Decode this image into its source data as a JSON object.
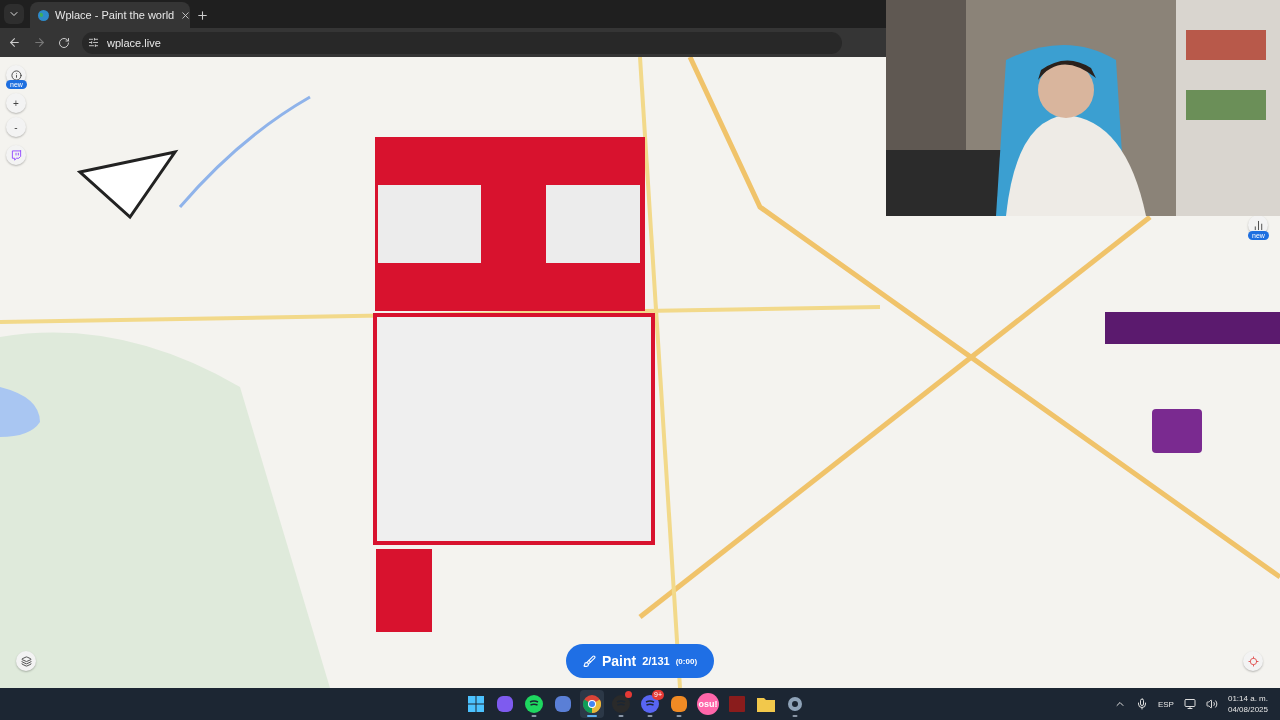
{
  "browser": {
    "tab": {
      "title": "Wplace - Paint the world",
      "selected": true
    },
    "url": "wplace.live"
  },
  "map_controls": {
    "info_badge": "new",
    "zoom_in": "+",
    "zoom_out": "-",
    "leaderboard_badge": "new"
  },
  "paint_button": {
    "label": "Paint",
    "count": "2/131",
    "timer": "(0:00)"
  },
  "taskbar": {
    "apps": [
      {
        "kind": "start",
        "running": false,
        "selected": false
      },
      {
        "kind": "copilot",
        "running": false,
        "selected": false
      },
      {
        "kind": "spotify",
        "running": true,
        "selected": false
      },
      {
        "kind": "vpn",
        "running": false,
        "selected": false
      },
      {
        "kind": "chrome",
        "running": true,
        "selected": true
      },
      {
        "kind": "obs",
        "running": true,
        "selected": false,
        "dot": true
      },
      {
        "kind": "discord",
        "running": true,
        "selected": false,
        "badge": "9+"
      },
      {
        "kind": "fl",
        "running": true,
        "selected": false
      },
      {
        "kind": "osu",
        "running": false,
        "selected": false,
        "label": "osu!"
      },
      {
        "kind": "game",
        "running": false,
        "selected": false
      },
      {
        "kind": "folder",
        "running": false,
        "selected": false
      },
      {
        "kind": "settings",
        "running": true,
        "selected": false
      }
    ],
    "language": "ESP",
    "time": "01:14 a. m.",
    "date": "04/08/2025"
  }
}
